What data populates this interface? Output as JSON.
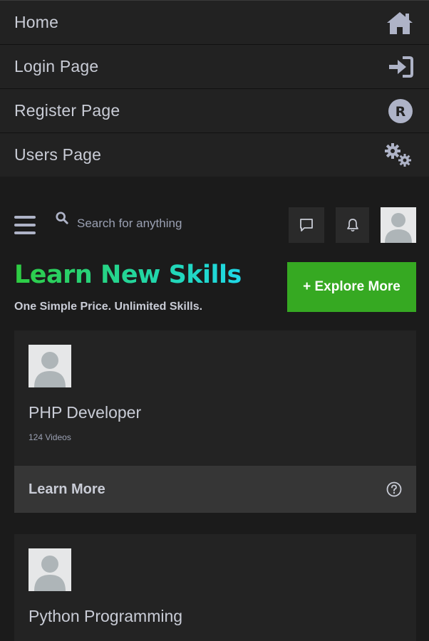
{
  "nav": {
    "items": [
      {
        "label": "Home",
        "icon": "home-icon"
      },
      {
        "label": "Login Page",
        "icon": "sign-in-icon"
      },
      {
        "label": "Register Page",
        "icon": "register-r-icon"
      },
      {
        "label": "Users Page",
        "icon": "gears-icon"
      }
    ]
  },
  "topbar": {
    "search_placeholder": "Search for anything"
  },
  "hero": {
    "title": "Learn New Skills",
    "subtitle": "One Simple Price. Unlimited Skills.",
    "explore_label": "+ Explore More"
  },
  "cards": [
    {
      "title": "PHP Developer",
      "count": "124 Videos",
      "footer_label": "Learn More"
    },
    {
      "title": "Python Programming"
    }
  ],
  "colors": {
    "background": "#1b1b1b",
    "nav_bg": "#222222",
    "accent_green": "#36a922",
    "text": "#c9ccd6"
  }
}
